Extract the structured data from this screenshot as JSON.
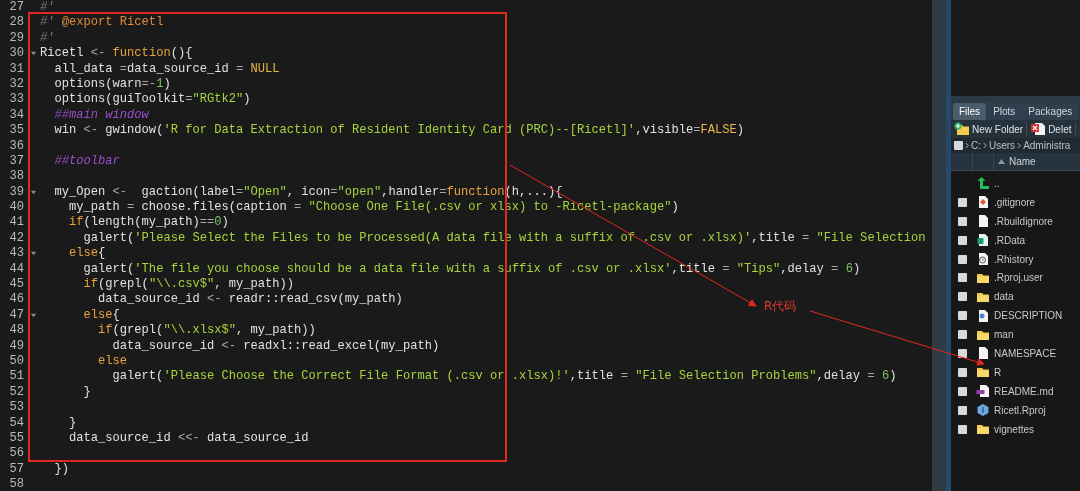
{
  "editor": {
    "lines": [
      {
        "number": "27",
        "fold": false,
        "tokens": [
          {
            "text": "#'",
            "kind": "comment"
          }
        ]
      },
      {
        "number": "28",
        "fold": false,
        "tokens": [
          {
            "text": "#' ",
            "kind": "comment"
          },
          {
            "text": "@export Ricetl",
            "kind": "doc-tag"
          }
        ]
      },
      {
        "number": "29",
        "fold": false,
        "tokens": [
          {
            "text": "#'",
            "kind": "comment"
          }
        ]
      },
      {
        "number": "30",
        "fold": true,
        "tokens": [
          {
            "text": "Ricetl ",
            "kind": "plain"
          },
          {
            "text": "<- ",
            "kind": "operator"
          },
          {
            "text": "function",
            "kind": "keyword"
          },
          {
            "text": "(){",
            "kind": "plain"
          }
        ]
      },
      {
        "number": "31",
        "fold": false,
        "tokens": [
          {
            "text": "  all_data ",
            "kind": "plain"
          },
          {
            "text": "=",
            "kind": "operator"
          },
          {
            "text": "data_source_id ",
            "kind": "plain"
          },
          {
            "text": "= ",
            "kind": "operator"
          },
          {
            "text": "NULL",
            "kind": "constant"
          }
        ]
      },
      {
        "number": "32",
        "fold": false,
        "tokens": [
          {
            "text": "  options(warn",
            "kind": "plain"
          },
          {
            "text": "=-",
            "kind": "operator"
          },
          {
            "text": "1",
            "kind": "number"
          },
          {
            "text": ")",
            "kind": "plain"
          }
        ]
      },
      {
        "number": "33",
        "fold": false,
        "tokens": [
          {
            "text": "  options(guiToolkit",
            "kind": "plain"
          },
          {
            "text": "=",
            "kind": "operator"
          },
          {
            "text": "\"RGtk2\"",
            "kind": "string"
          },
          {
            "text": ")",
            "kind": "plain"
          }
        ]
      },
      {
        "number": "34",
        "fold": false,
        "tokens": [
          {
            "text": "  ##main window",
            "kind": "section-comment"
          }
        ]
      },
      {
        "number": "35",
        "fold": false,
        "tokens": [
          {
            "text": "  win ",
            "kind": "plain"
          },
          {
            "text": "<- ",
            "kind": "operator"
          },
          {
            "text": "gwindow(",
            "kind": "plain"
          },
          {
            "text": "'R for Data Extraction of Resident Identity Card (PRC)--[Ricetl]'",
            "kind": "string"
          },
          {
            "text": ",visible",
            "kind": "plain"
          },
          {
            "text": "=",
            "kind": "operator"
          },
          {
            "text": "FALSE",
            "kind": "constant"
          },
          {
            "text": ")",
            "kind": "plain"
          }
        ]
      },
      {
        "number": "36",
        "fold": false
      },
      {
        "number": "37",
        "fold": false,
        "tokens": [
          {
            "text": "  ##toolbar",
            "kind": "section-comment"
          }
        ]
      },
      {
        "number": "38",
        "fold": false
      },
      {
        "number": "39",
        "fold": true,
        "tokens": [
          {
            "text": "  my_Open ",
            "kind": "plain"
          },
          {
            "text": "<-  ",
            "kind": "operator"
          },
          {
            "text": "gaction(label",
            "kind": "plain"
          },
          {
            "text": "=",
            "kind": "operator"
          },
          {
            "text": "\"Open\"",
            "kind": "string"
          },
          {
            "text": ", icon",
            "kind": "plain"
          },
          {
            "text": "=",
            "kind": "operator"
          },
          {
            "text": "\"open\"",
            "kind": "string"
          },
          {
            "text": ",handler",
            "kind": "plain"
          },
          {
            "text": "=",
            "kind": "operator"
          },
          {
            "text": "function",
            "kind": "keyword"
          },
          {
            "text": "(h,...){",
            "kind": "plain"
          }
        ]
      },
      {
        "number": "40",
        "fold": false,
        "tokens": [
          {
            "text": "    my_path ",
            "kind": "plain"
          },
          {
            "text": "= ",
            "kind": "operator"
          },
          {
            "text": "choose.files(caption ",
            "kind": "plain"
          },
          {
            "text": "= ",
            "kind": "operator"
          },
          {
            "text": "\"Choose One File(.csv or xlsx) to -Ricetl-package\"",
            "kind": "string"
          },
          {
            "text": ")",
            "kind": "plain"
          }
        ]
      },
      {
        "number": "41",
        "fold": false,
        "tokens": [
          {
            "text": "    if",
            "kind": "keyword"
          },
          {
            "text": "(length(my_path)",
            "kind": "plain"
          },
          {
            "text": "==",
            "kind": "operator"
          },
          {
            "text": "0",
            "kind": "number"
          },
          {
            "text": ")",
            "kind": "plain"
          }
        ]
      },
      {
        "number": "42",
        "fold": false,
        "tokens": [
          {
            "text": "      galert(",
            "kind": "plain"
          },
          {
            "text": "'Please Select the Files to be Processed(A data file with a suffix of .csv or .xlsx)'",
            "kind": "string"
          },
          {
            "text": ",title ",
            "kind": "plain"
          },
          {
            "text": "= ",
            "kind": "operator"
          },
          {
            "text": "\"File Selection",
            "kind": "string"
          }
        ]
      },
      {
        "number": "43",
        "fold": true,
        "tokens": [
          {
            "text": "    else",
            "kind": "keyword"
          },
          {
            "text": "{",
            "kind": "plain"
          }
        ]
      },
      {
        "number": "44",
        "fold": false,
        "tokens": [
          {
            "text": "      galert(",
            "kind": "plain"
          },
          {
            "text": "'The file you choose should be a data file with a suffix of .csv or .xlsx'",
            "kind": "string"
          },
          {
            "text": ",title ",
            "kind": "plain"
          },
          {
            "text": "= ",
            "kind": "operator"
          },
          {
            "text": "\"Tips\"",
            "kind": "string"
          },
          {
            "text": ",delay ",
            "kind": "plain"
          },
          {
            "text": "= ",
            "kind": "operator"
          },
          {
            "text": "6",
            "kind": "number"
          },
          {
            "text": ")",
            "kind": "plain"
          }
        ]
      },
      {
        "number": "45",
        "fold": false,
        "tokens": [
          {
            "text": "      if",
            "kind": "keyword"
          },
          {
            "text": "(grepl(",
            "kind": "plain"
          },
          {
            "text": "\"\\\\.csv$\"",
            "kind": "string"
          },
          {
            "text": ", my_path))",
            "kind": "plain"
          }
        ]
      },
      {
        "number": "46",
        "fold": false,
        "tokens": [
          {
            "text": "        data_source_id ",
            "kind": "plain"
          },
          {
            "text": "<- ",
            "kind": "operator"
          },
          {
            "text": "readr::read_csv(my_path)",
            "kind": "plain"
          }
        ]
      },
      {
        "number": "47",
        "fold": true,
        "tokens": [
          {
            "text": "      else",
            "kind": "keyword"
          },
          {
            "text": "{",
            "kind": "plain"
          }
        ]
      },
      {
        "number": "48",
        "fold": false,
        "tokens": [
          {
            "text": "        if",
            "kind": "keyword"
          },
          {
            "text": "(grepl(",
            "kind": "plain"
          },
          {
            "text": "\"\\\\.xlsx$\"",
            "kind": "string"
          },
          {
            "text": ", my_path))",
            "kind": "plain"
          }
        ]
      },
      {
        "number": "49",
        "fold": false,
        "tokens": [
          {
            "text": "          data_source_id ",
            "kind": "plain"
          },
          {
            "text": "<- ",
            "kind": "operator"
          },
          {
            "text": "readxl::read_excel(my_path)",
            "kind": "plain"
          }
        ]
      },
      {
        "number": "50",
        "fold": false,
        "tokens": [
          {
            "text": "        else",
            "kind": "keyword"
          }
        ]
      },
      {
        "number": "51",
        "fold": false,
        "tokens": [
          {
            "text": "          galert(",
            "kind": "plain"
          },
          {
            "text": "'Please Choose the Correct File Format (.csv or .xlsx)!'",
            "kind": "string"
          },
          {
            "text": ",title ",
            "kind": "plain"
          },
          {
            "text": "= ",
            "kind": "operator"
          },
          {
            "text": "\"File Selection Problems\"",
            "kind": "string"
          },
          {
            "text": ",delay ",
            "kind": "plain"
          },
          {
            "text": "= ",
            "kind": "operator"
          },
          {
            "text": "6",
            "kind": "number"
          },
          {
            "text": ")",
            "kind": "plain"
          }
        ]
      },
      {
        "number": "52",
        "fold": false,
        "tokens": [
          {
            "text": "      }",
            "kind": "plain"
          }
        ]
      },
      {
        "number": "53",
        "fold": false
      },
      {
        "number": "54",
        "fold": false,
        "tokens": [
          {
            "text": "    }",
            "kind": "plain"
          }
        ]
      },
      {
        "number": "55",
        "fold": false,
        "tokens": [
          {
            "text": "    data_source_id ",
            "kind": "plain"
          },
          {
            "text": "<<- ",
            "kind": "operator"
          },
          {
            "text": "data_source_id",
            "kind": "plain"
          }
        ]
      },
      {
        "number": "56",
        "fold": false
      },
      {
        "number": "57",
        "fold": false,
        "tokens": [
          {
            "text": "  })",
            "kind": "plain"
          }
        ]
      },
      {
        "number": "58",
        "fold": false
      }
    ]
  },
  "files_pane": {
    "tabs": [
      {
        "label": "Files",
        "selected": true
      },
      {
        "label": "Plots",
        "selected": false
      },
      {
        "label": "Packages",
        "selected": false
      }
    ],
    "toolbar": [
      {
        "label": "New Folder",
        "kind": "new-folder"
      },
      {
        "label": "Delet",
        "kind": "delete"
      }
    ],
    "breadcrumb": {
      "checked": false,
      "parts": [
        "C:",
        "Users",
        "Administra"
      ]
    },
    "columns": [
      {
        "label": "Name",
        "sorted": true
      }
    ],
    "rows": [
      {
        "name": "..",
        "kind": "up"
      },
      {
        "name": ".gitignore",
        "kind": "git",
        "checked": false
      },
      {
        "name": ".Rbuildignore",
        "kind": "file",
        "checked": false
      },
      {
        "name": ".RData",
        "kind": "rdata",
        "checked": false
      },
      {
        "name": ".Rhistory",
        "kind": "history",
        "checked": false
      },
      {
        "name": ".Rproj.user",
        "kind": "folder",
        "checked": false
      },
      {
        "name": "data",
        "kind": "folder",
        "checked": false
      },
      {
        "name": "DESCRIPTION",
        "kind": "description",
        "checked": false
      },
      {
        "name": "man",
        "kind": "folder",
        "checked": false
      },
      {
        "name": "NAMESPACE",
        "kind": "file",
        "checked": false
      },
      {
        "name": "R",
        "kind": "folder",
        "checked": false
      },
      {
        "name": "README.md",
        "kind": "markdown",
        "checked": false
      },
      {
        "name": "Ricetl.Rproj",
        "kind": "rproj",
        "checked": false
      },
      {
        "name": "vignettes",
        "kind": "folder",
        "checked": false
      }
    ]
  },
  "annotation": {
    "label": "R代码"
  }
}
